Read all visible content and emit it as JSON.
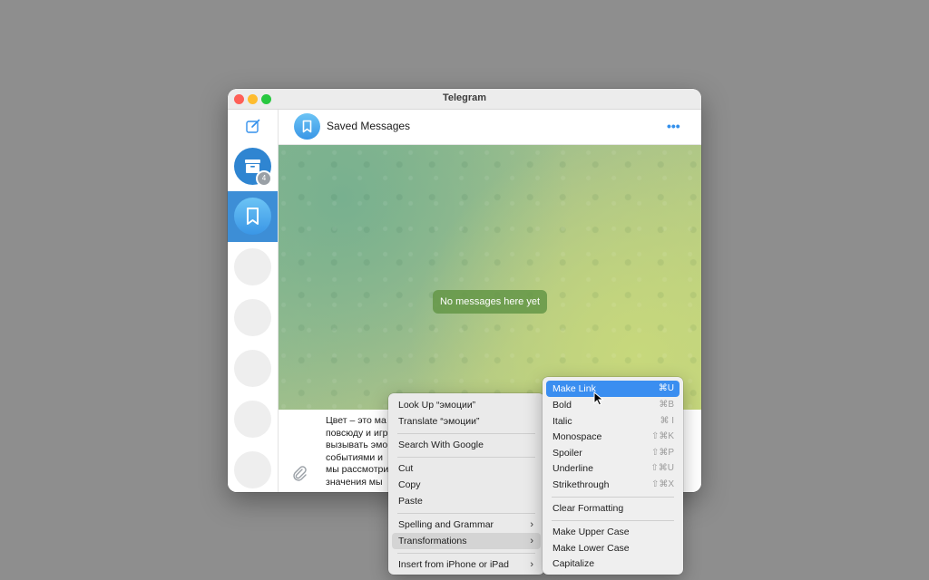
{
  "window": {
    "title": "Telegram"
  },
  "sidebar": {
    "archive_badge": "4"
  },
  "chat": {
    "title": "Saved Messages",
    "more": "•••",
    "empty_label": "No messages here yet",
    "draft_lines": [
      "Цвет – это ма",
      "повсюду и игр",
      "вызывать эмо",
      "событиями и",
      "мы рассмотри",
      "значения мы"
    ]
  },
  "context_menu": {
    "look_up": "Look Up “эмоции”",
    "translate": "Translate “эмоции”",
    "search_google": "Search With Google",
    "cut": "Cut",
    "copy": "Copy",
    "paste": "Paste",
    "spelling": "Spelling and Grammar",
    "transformations": "Transformations",
    "insert_iphone": "Insert from iPhone or iPad"
  },
  "submenu": {
    "make_link": "Make Link",
    "make_link_sc": "⌘U",
    "bold": "Bold",
    "bold_sc": "⌘B",
    "italic": "Italic",
    "italic_sc": "⌘ I",
    "monospace": "Monospace",
    "monospace_sc": "⇧⌘K",
    "spoiler": "Spoiler",
    "spoiler_sc": "⇧⌘P",
    "underline": "Underline",
    "underline_sc": "⇧⌘U",
    "strikethrough": "Strikethrough",
    "strikethrough_sc": "⇧⌘X",
    "clear_formatting": "Clear Formatting",
    "upper": "Make Upper Case",
    "lower": "Make Lower Case",
    "capitalize": "Capitalize"
  },
  "icons": {
    "compose": "compose-icon",
    "archive": "archive-icon",
    "bookmark": "bookmark-icon",
    "attach": "paperclip-icon"
  },
  "colors": {
    "accent": "#3390ec",
    "selection": "#3d8ed6",
    "menu_highlight": "#3a8ef0"
  }
}
